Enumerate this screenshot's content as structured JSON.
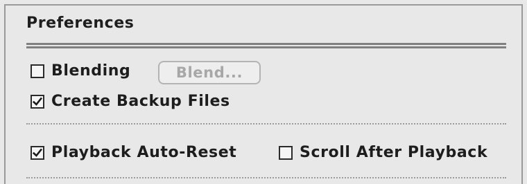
{
  "panel": {
    "title": "Preferences"
  },
  "options": {
    "blending": {
      "label": "Blending",
      "checked": false
    },
    "blend_button": {
      "label": "Blend...",
      "enabled": false
    },
    "create_backup_files": {
      "label": "Create Backup Files",
      "checked": true
    },
    "playback_auto_reset": {
      "label": "Playback Auto-Reset",
      "checked": true
    },
    "scroll_after_playback": {
      "label": "Scroll After Playback",
      "checked": false
    }
  }
}
